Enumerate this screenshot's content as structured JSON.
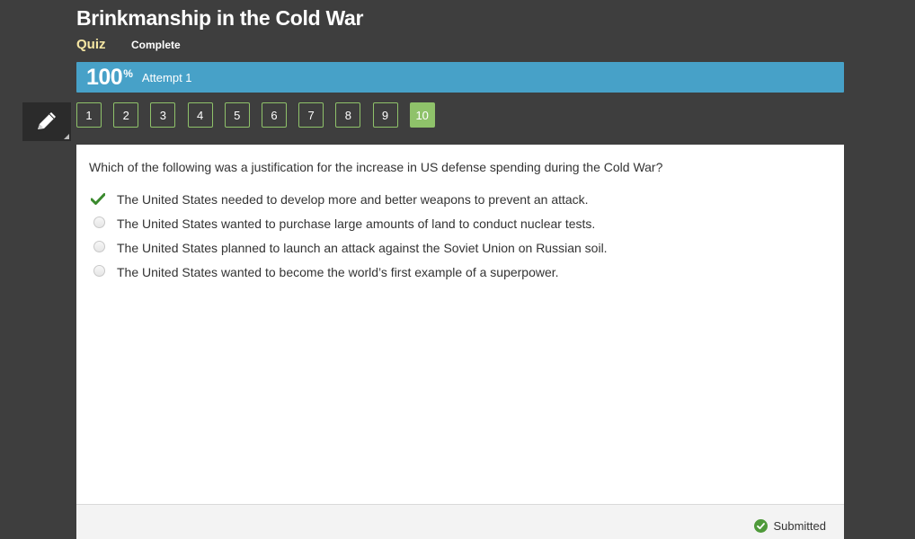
{
  "header": {
    "title": "Brinkmanship in the Cold War",
    "type_label": "Quiz",
    "status_label": "Complete"
  },
  "score": {
    "value": "100",
    "percent_sign": "%",
    "attempt_label": "Attempt 1"
  },
  "toolbar": {
    "tool_icon": "pencil-icon"
  },
  "question_nav": {
    "items": [
      "1",
      "2",
      "3",
      "4",
      "5",
      "6",
      "7",
      "8",
      "9",
      "10"
    ],
    "active": "10"
  },
  "question": {
    "text": "Which of the following was a justification for the increase in US defense spending during the Cold War?",
    "options": [
      {
        "text": "The United States needed to develop more and better weapons to prevent an attack.",
        "state": "correct"
      },
      {
        "text": "The United States wanted to purchase large amounts of land to conduct nuclear tests.",
        "state": "unselected"
      },
      {
        "text": "The United States planned to launch an attack against the Soviet Union on Russian soil.",
        "state": "unselected"
      },
      {
        "text": "The United States wanted to become the world’s first example of a superpower.",
        "state": "unselected"
      }
    ]
  },
  "footer": {
    "status_text": "Submitted",
    "status_icon": "check-circle-icon"
  },
  "colors": {
    "background": "#3e3e3e",
    "score_bar": "#47a1c8",
    "quiz_label": "#f5e6a3",
    "nav_green": "#8fc26a",
    "check_green": "#3b8a2e"
  }
}
